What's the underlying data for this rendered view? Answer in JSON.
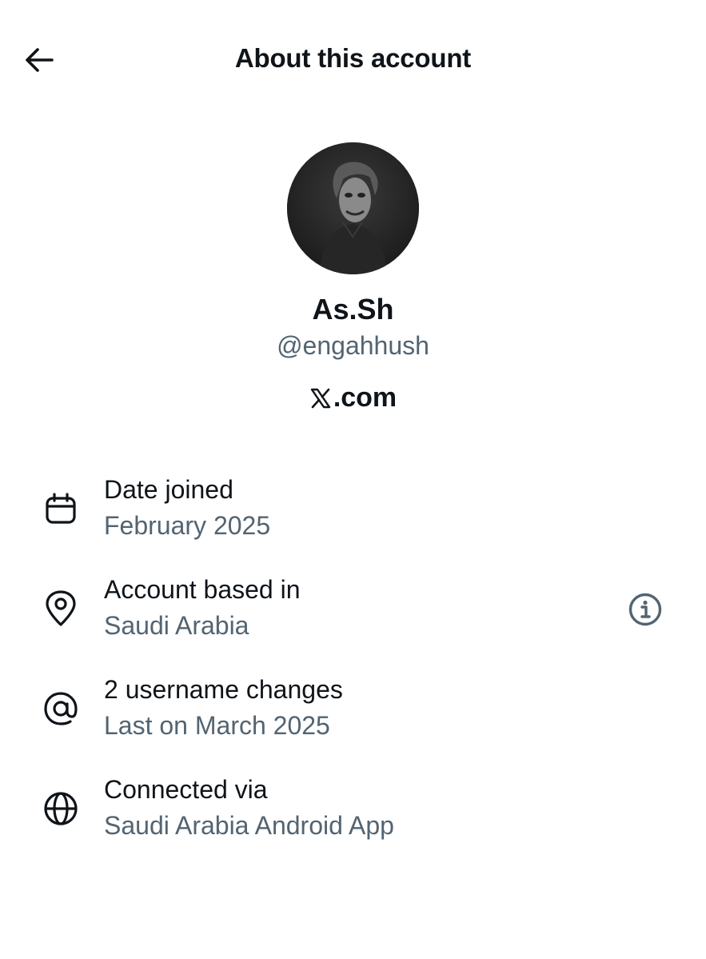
{
  "header": {
    "title": "About this account",
    "back_icon": "arrow-left-icon"
  },
  "profile": {
    "display_name": "As.Sh",
    "handle": "@engahhush",
    "domain_suffix": ".com",
    "domain_logo": "x-logo-icon"
  },
  "details": [
    {
      "icon": "calendar-icon",
      "label": "Date joined",
      "value": "February 2025"
    },
    {
      "icon": "location-pin-icon",
      "label": "Account based in",
      "value": "Saudi Arabia"
    },
    {
      "icon": "at-sign-icon",
      "label": "2 username changes",
      "value": "Last on March 2025"
    },
    {
      "icon": "globe-icon",
      "label": "Connected via",
      "value": "Saudi Arabia Android App"
    }
  ],
  "info_icon": "info-circle-icon",
  "colors": {
    "primary_text": "#0f1419",
    "secondary_text": "#536471",
    "background": "#ffffff"
  }
}
